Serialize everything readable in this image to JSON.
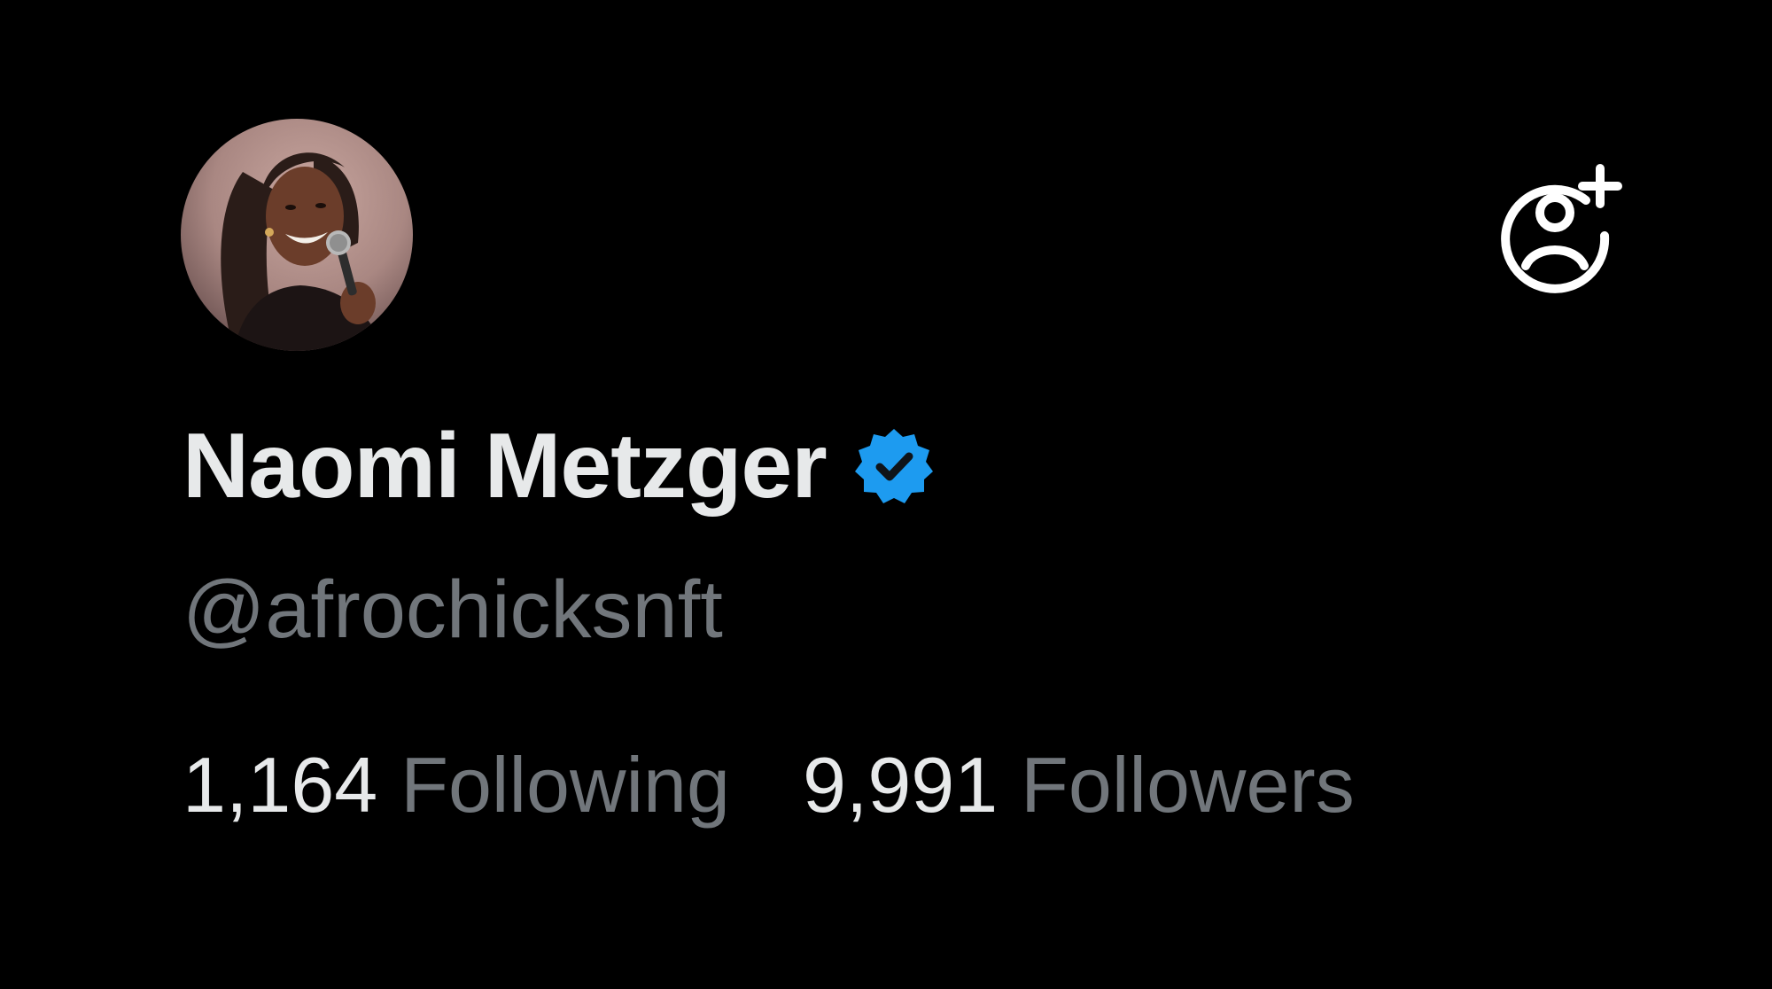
{
  "profile": {
    "display_name": "Naomi Metzger",
    "handle": "@afrochicksnft",
    "verified": true,
    "avatar_icon": "profile-photo",
    "follow_icon": "add-user-icon"
  },
  "stats": {
    "following_count": "1,164",
    "following_label": "Following",
    "followers_count": "9,991",
    "followers_label": "Followers"
  },
  "colors": {
    "background": "#000000",
    "primary_text": "#e7e9ea",
    "secondary_text": "#71767b",
    "verified_blue": "#1d9bf0"
  }
}
